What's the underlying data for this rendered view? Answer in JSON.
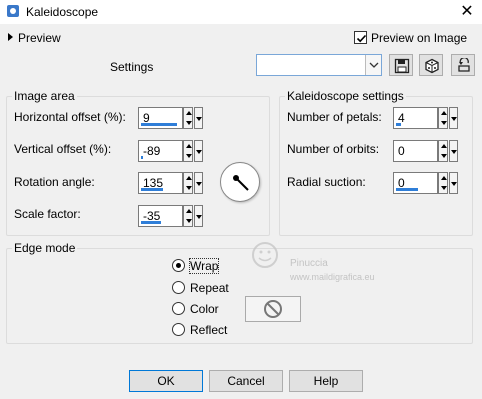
{
  "window": {
    "title": "Kaleidoscope",
    "app_icon": "paintshop-icon",
    "close_glyph": "✕"
  },
  "preview": {
    "label": "Preview",
    "preview_on_image_label": "Preview on Image",
    "preview_on_image_checked": true
  },
  "settings": {
    "label": "Settings",
    "combo_value": "",
    "buttons": [
      "save-preset-icon",
      "randomize-icon",
      "reset-defaults-icon"
    ]
  },
  "image_area": {
    "title": "Image area",
    "fields": [
      {
        "label": "Horizontal offset (%):",
        "value": "9"
      },
      {
        "label": "Vertical offset (%):",
        "value": "-89"
      },
      {
        "label": "Rotation angle:",
        "value": "135"
      },
      {
        "label": "Scale factor:",
        "value": "-35"
      }
    ]
  },
  "kaleidoscope_settings": {
    "title": "Kaleidoscope settings",
    "fields": [
      {
        "label": "Number of petals:",
        "value": "4"
      },
      {
        "label": "Number of orbits:",
        "value": "0"
      },
      {
        "label": "Radial suction:",
        "value": "0"
      }
    ]
  },
  "edge_mode": {
    "title": "Edge mode",
    "options": [
      "Wrap",
      "Repeat",
      "Color",
      "Reflect"
    ],
    "selected": "Wrap"
  },
  "buttons": {
    "ok": "OK",
    "cancel": "Cancel",
    "help": "Help"
  },
  "watermark": {
    "name": "Pinuccia",
    "site": "www.maildigrafica.eu"
  },
  "colors": {
    "accent": "#2f7ed8",
    "focus_border": "#0078d7"
  }
}
